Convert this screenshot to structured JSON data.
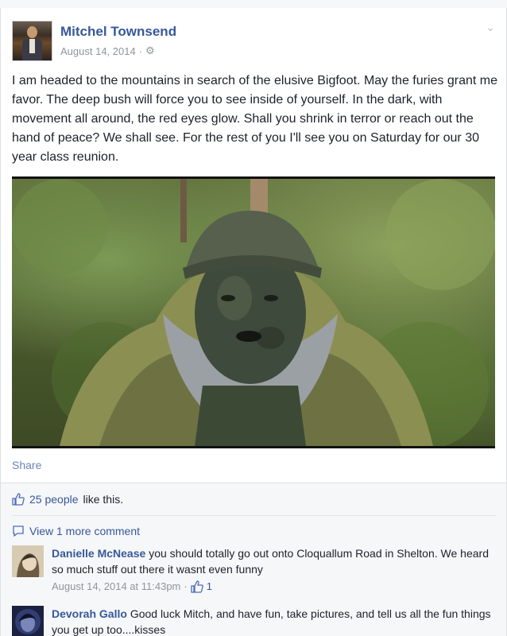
{
  "post": {
    "author": "Mitchel Townsend",
    "date": "August 14, 2014",
    "meta_separator": "·",
    "text": "I am headed to the mountains in search of the elusive Bigfoot. May the furies grant me favor. The deep bush will force you to see inside of yourself. In the dark, with movement all around, the red eyes glow. Shall you shrink in terror or reach out the hand of peace? We shall see. For the rest of you I'll see you on Saturday for our 30 year class reunion.",
    "share_label": "Share"
  },
  "likes": {
    "count_text": "25 people",
    "suffix": "like this."
  },
  "comments": {
    "view_more": "View 1 more comment",
    "items": [
      {
        "name": "Danielle McNease",
        "text": "you should totally go out onto Cloquallum Road in Shelton. We heard so much stuff out there it wasnt even funny",
        "time": "August 14, 2014 at 11:43pm",
        "separator": "·",
        "likes": "1"
      },
      {
        "name": "Devorah Gallo",
        "text": "Good luck Mitch, and have fun, take pictures, and tell us all the fun things you get up too....kisses"
      }
    ]
  },
  "icons": {
    "audience": "gear-icon",
    "menu": "chevron-down-icon",
    "like": "thumbs-up-icon",
    "comment": "speech-bubble-icon"
  },
  "colors": {
    "link": "#365899",
    "text": "#1d2129",
    "meta": "#90949c",
    "background": "#e9ebee"
  }
}
